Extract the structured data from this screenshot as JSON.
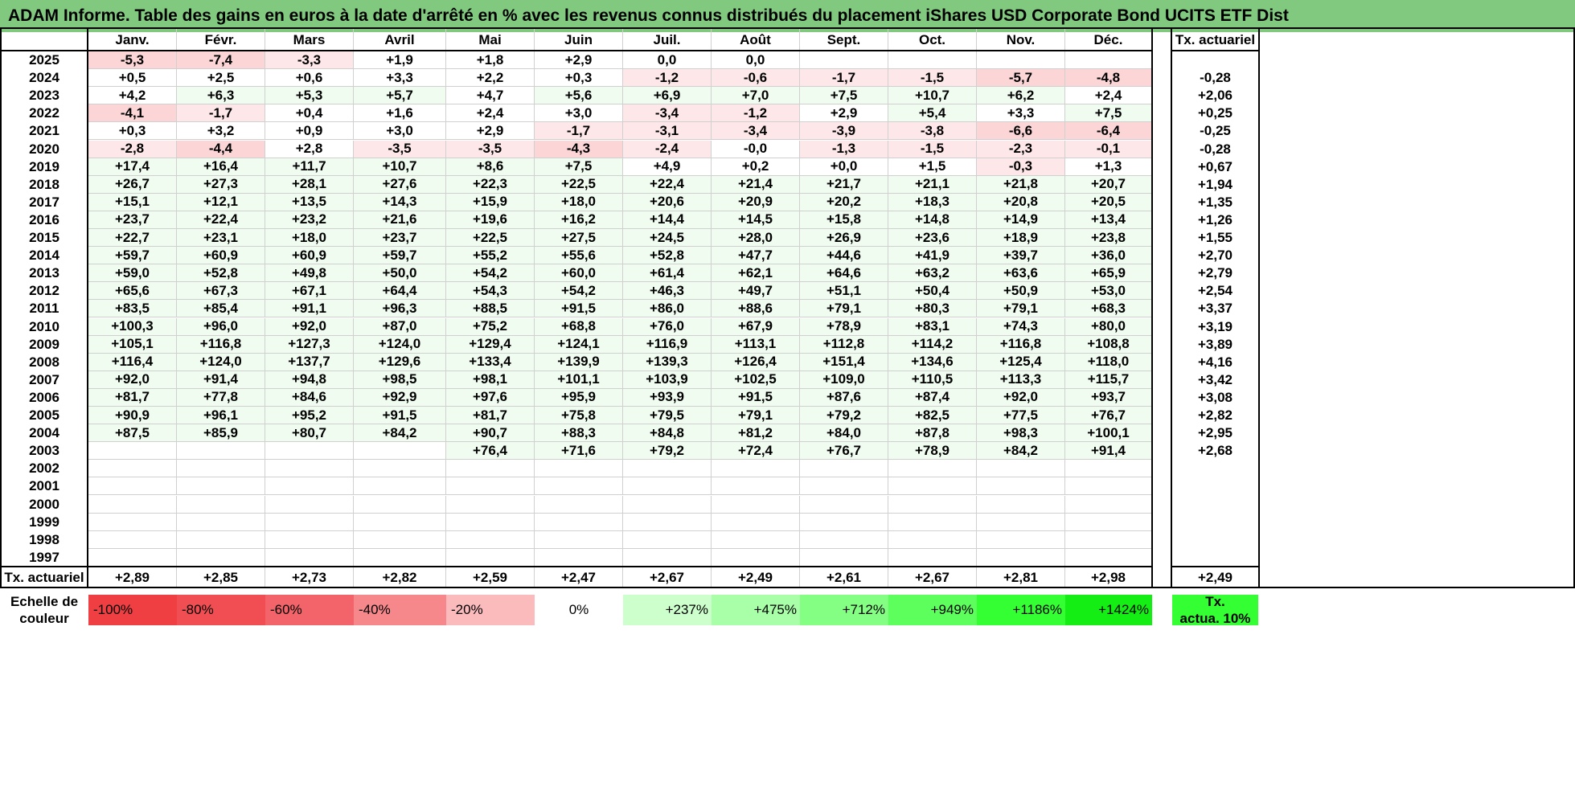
{
  "title": "ADAM Informe. Table des gains en euros à la date d'arrêté en % avec les revenus connus distribués du placement iShares USD Corporate Bond UCITS ETF Dist",
  "months": [
    "Janv.",
    "Févr.",
    "Mars",
    "Avril",
    "Mai",
    "Juin",
    "Juil.",
    "Août",
    "Sept.",
    "Oct.",
    "Nov.",
    "Déc."
  ],
  "tx_header": "Tx. actuariel",
  "rows": [
    {
      "year": "2025",
      "values": [
        "-5,3",
        "-7,4",
        "-3,3",
        "+1,9",
        "+1,8",
        "+2,9",
        "0,0",
        "0,0",
        "",
        "",
        "",
        ""
      ],
      "tx": ""
    },
    {
      "year": "2024",
      "values": [
        "+0,5",
        "+2,5",
        "+0,6",
        "+3,3",
        "+2,2",
        "+0,3",
        "-1,2",
        "-0,6",
        "-1,7",
        "-1,5",
        "-5,7",
        "-4,8"
      ],
      "tx": "-0,28"
    },
    {
      "year": "2023",
      "values": [
        "+4,2",
        "+6,3",
        "+5,3",
        "+5,7",
        "+4,7",
        "+5,6",
        "+6,9",
        "+7,0",
        "+7,5",
        "+10,7",
        "+6,2",
        "+2,4"
      ],
      "tx": "+2,06"
    },
    {
      "year": "2022",
      "values": [
        "-4,1",
        "-1,7",
        "+0,4",
        "+1,6",
        "+2,4",
        "+3,0",
        "-3,4",
        "-1,2",
        "+2,9",
        "+5,4",
        "+3,3",
        "+7,5"
      ],
      "tx": "+0,25"
    },
    {
      "year": "2021",
      "values": [
        "+0,3",
        "+3,2",
        "+0,9",
        "+3,0",
        "+2,9",
        "-1,7",
        "-3,1",
        "-3,4",
        "-3,9",
        "-3,8",
        "-6,6",
        "-6,4"
      ],
      "tx": "-0,25"
    },
    {
      "year": "2020",
      "values": [
        "-2,8",
        "-4,4",
        "+2,8",
        "-3,5",
        "-3,5",
        "-4,3",
        "-2,4",
        "-0,0",
        "-1,3",
        "-1,5",
        "-2,3",
        "-0,1"
      ],
      "tx": "-0,28"
    },
    {
      "year": "2019",
      "values": [
        "+17,4",
        "+16,4",
        "+11,7",
        "+10,7",
        "+8,6",
        "+7,5",
        "+4,9",
        "+0,2",
        "+0,0",
        "+1,5",
        "-0,3",
        "+1,3"
      ],
      "tx": "+0,67"
    },
    {
      "year": "2018",
      "values": [
        "+26,7",
        "+27,3",
        "+28,1",
        "+27,6",
        "+22,3",
        "+22,5",
        "+22,4",
        "+21,4",
        "+21,7",
        "+21,1",
        "+21,8",
        "+20,7"
      ],
      "tx": "+1,94"
    },
    {
      "year": "2017",
      "values": [
        "+15,1",
        "+12,1",
        "+13,5",
        "+14,3",
        "+15,9",
        "+18,0",
        "+20,6",
        "+20,9",
        "+20,2",
        "+18,3",
        "+20,8",
        "+20,5"
      ],
      "tx": "+1,35"
    },
    {
      "year": "2016",
      "values": [
        "+23,7",
        "+22,4",
        "+23,2",
        "+21,6",
        "+19,6",
        "+16,2",
        "+14,4",
        "+14,5",
        "+15,8",
        "+14,8",
        "+14,9",
        "+13,4"
      ],
      "tx": "+1,26"
    },
    {
      "year": "2015",
      "values": [
        "+22,7",
        "+23,1",
        "+18,0",
        "+23,7",
        "+22,5",
        "+27,5",
        "+24,5",
        "+28,0",
        "+26,9",
        "+23,6",
        "+18,9",
        "+23,8"
      ],
      "tx": "+1,55"
    },
    {
      "year": "2014",
      "values": [
        "+59,7",
        "+60,9",
        "+60,9",
        "+59,7",
        "+55,2",
        "+55,6",
        "+52,8",
        "+47,7",
        "+44,6",
        "+41,9",
        "+39,7",
        "+36,0"
      ],
      "tx": "+2,70"
    },
    {
      "year": "2013",
      "values": [
        "+59,0",
        "+52,8",
        "+49,8",
        "+50,0",
        "+54,2",
        "+60,0",
        "+61,4",
        "+62,1",
        "+64,6",
        "+63,2",
        "+63,6",
        "+65,9"
      ],
      "tx": "+2,79"
    },
    {
      "year": "2012",
      "values": [
        "+65,6",
        "+67,3",
        "+67,1",
        "+64,4",
        "+54,3",
        "+54,2",
        "+46,3",
        "+49,7",
        "+51,1",
        "+50,4",
        "+50,9",
        "+53,0"
      ],
      "tx": "+2,54"
    },
    {
      "year": "2011",
      "values": [
        "+83,5",
        "+85,4",
        "+91,1",
        "+96,3",
        "+88,5",
        "+91,5",
        "+86,0",
        "+88,6",
        "+79,1",
        "+80,3",
        "+79,1",
        "+68,3"
      ],
      "tx": "+3,37"
    },
    {
      "year": "2010",
      "values": [
        "+100,3",
        "+96,0",
        "+92,0",
        "+87,0",
        "+75,2",
        "+68,8",
        "+76,0",
        "+67,9",
        "+78,9",
        "+83,1",
        "+74,3",
        "+80,0"
      ],
      "tx": "+3,19"
    },
    {
      "year": "2009",
      "values": [
        "+105,1",
        "+116,8",
        "+127,3",
        "+124,0",
        "+129,4",
        "+124,1",
        "+116,9",
        "+113,1",
        "+112,8",
        "+114,2",
        "+116,8",
        "+108,8"
      ],
      "tx": "+3,89"
    },
    {
      "year": "2008",
      "values": [
        "+116,4",
        "+124,0",
        "+137,7",
        "+129,6",
        "+133,4",
        "+139,9",
        "+139,3",
        "+126,4",
        "+151,4",
        "+134,6",
        "+125,4",
        "+118,0"
      ],
      "tx": "+4,16"
    },
    {
      "year": "2007",
      "values": [
        "+92,0",
        "+91,4",
        "+94,8",
        "+98,5",
        "+98,1",
        "+101,1",
        "+103,9",
        "+102,5",
        "+109,0",
        "+110,5",
        "+113,3",
        "+115,7"
      ],
      "tx": "+3,42"
    },
    {
      "year": "2006",
      "values": [
        "+81,7",
        "+77,8",
        "+84,6",
        "+92,9",
        "+97,6",
        "+95,9",
        "+93,9",
        "+91,5",
        "+87,6",
        "+87,4",
        "+92,0",
        "+93,7"
      ],
      "tx": "+3,08"
    },
    {
      "year": "2005",
      "values": [
        "+90,9",
        "+96,1",
        "+95,2",
        "+91,5",
        "+81,7",
        "+75,8",
        "+79,5",
        "+79,1",
        "+79,2",
        "+82,5",
        "+77,5",
        "+76,7"
      ],
      "tx": "+2,82"
    },
    {
      "year": "2004",
      "values": [
        "+87,5",
        "+85,9",
        "+80,7",
        "+84,2",
        "+90,7",
        "+88,3",
        "+84,8",
        "+81,2",
        "+84,0",
        "+87,8",
        "+98,3",
        "+100,1"
      ],
      "tx": "+2,95"
    },
    {
      "year": "2003",
      "values": [
        "",
        "",
        "",
        "",
        "+76,4",
        "+71,6",
        "+79,2",
        "+72,4",
        "+76,7",
        "+78,9",
        "+84,2",
        "+91,4"
      ],
      "tx": "+2,68"
    },
    {
      "year": "2002",
      "values": [
        "",
        "",
        "",
        "",
        "",
        "",
        "",
        "",
        "",
        "",
        "",
        ""
      ],
      "tx": ""
    },
    {
      "year": "2001",
      "values": [
        "",
        "",
        "",
        "",
        "",
        "",
        "",
        "",
        "",
        "",
        "",
        ""
      ],
      "tx": ""
    },
    {
      "year": "2000",
      "values": [
        "",
        "",
        "",
        "",
        "",
        "",
        "",
        "",
        "",
        "",
        "",
        ""
      ],
      "tx": ""
    },
    {
      "year": "1999",
      "values": [
        "",
        "",
        "",
        "",
        "",
        "",
        "",
        "",
        "",
        "",
        "",
        ""
      ],
      "tx": ""
    },
    {
      "year": "1998",
      "values": [
        "",
        "",
        "",
        "",
        "",
        "",
        "",
        "",
        "",
        "",
        "",
        ""
      ],
      "tx": ""
    },
    {
      "year": "1997",
      "values": [
        "",
        "",
        "",
        "",
        "",
        "",
        "",
        "",
        "",
        "",
        "",
        ""
      ],
      "tx": ""
    }
  ],
  "footer": {
    "label": "Tx. actuariel",
    "values": [
      "+2,89",
      "+2,85",
      "+2,73",
      "+2,82",
      "+2,59",
      "+2,47",
      "+2,67",
      "+2,49",
      "+2,61",
      "+2,67",
      "+2,81",
      "+2,98"
    ],
    "tx": "+2,49"
  },
  "scale": {
    "label_line1": "Echelle de",
    "label_line2": "couleur",
    "items": [
      {
        "label": "-100%",
        "color": "#ef3f43"
      },
      {
        "label": "-80%",
        "color": "#f04e52"
      },
      {
        "label": "-60%",
        "color": "#f3646a"
      },
      {
        "label": "-40%",
        "color": "#f6878b"
      },
      {
        "label": "-20%",
        "color": "#fbbbbd"
      },
      {
        "label": "0%",
        "color": "#ffffff"
      },
      {
        "label": "+237%",
        "color": "#ccffcc"
      },
      {
        "label": "+475%",
        "color": "#a8ffa8"
      },
      {
        "label": "+712%",
        "color": "#84ff84"
      },
      {
        "label": "+949%",
        "color": "#5cff5c"
      },
      {
        "label": "+1186%",
        "color": "#33ff33"
      },
      {
        "label": "+1424%",
        "color": "#14ee14"
      }
    ],
    "tx_line1": "Tx.",
    "tx_line2": "actua. 10%",
    "tx_color": "#33ff33"
  },
  "colors": {
    "title_bg": "#80c97e",
    "neg_light": "#fde7e8",
    "neg_mid": "#fcd6d7",
    "pos_light": "#f1fcf1"
  }
}
